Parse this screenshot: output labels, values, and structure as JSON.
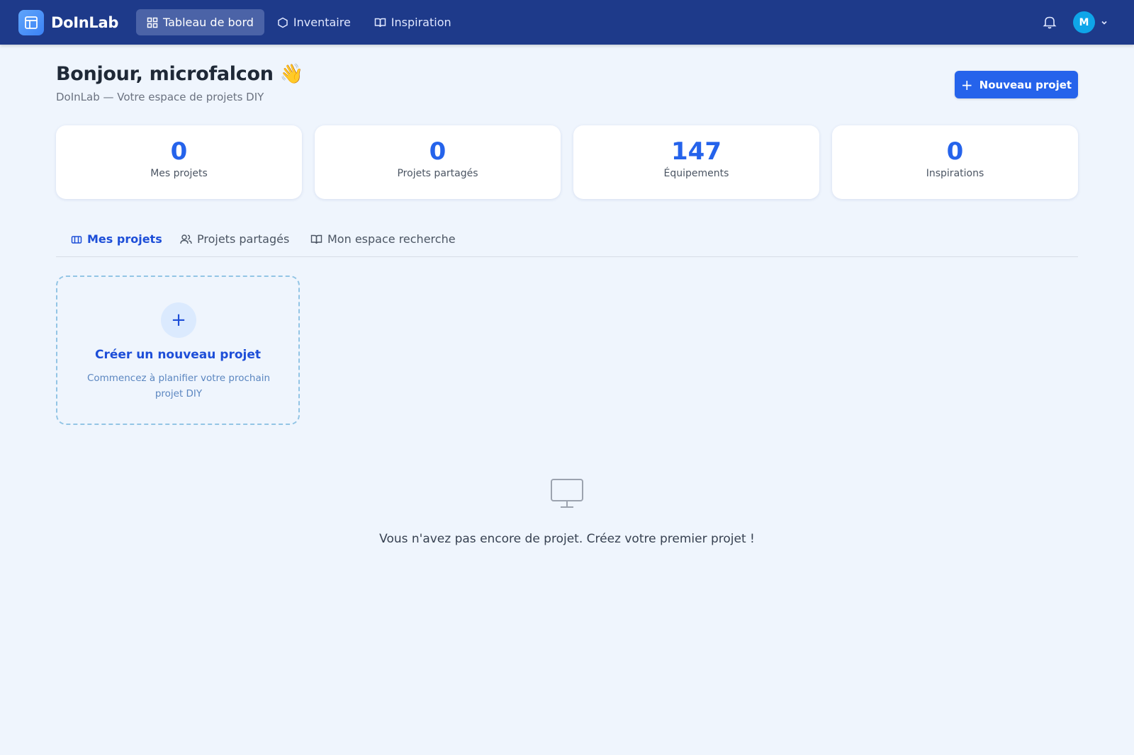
{
  "app": {
    "name": "DoInLab"
  },
  "nav": {
    "items": [
      {
        "label": "Tableau de bord",
        "icon": "dashboard-grid-icon",
        "active": true
      },
      {
        "label": "Inventaire",
        "icon": "hexagon-icon",
        "active": false
      },
      {
        "label": "Inspiration",
        "icon": "book-open-icon",
        "active": false
      }
    ]
  },
  "user": {
    "initial": "M"
  },
  "header": {
    "greeting": "Bonjour, microfalcon 👋",
    "subtitle": "DoInLab — Votre espace de projets DIY",
    "new_project_label": "Nouveau projet"
  },
  "stats": [
    {
      "value": "0",
      "label": "Mes projets"
    },
    {
      "value": "0",
      "label": "Projets partagés"
    },
    {
      "value": "147",
      "label": "Équipements"
    },
    {
      "value": "0",
      "label": "Inspirations"
    }
  ],
  "tabs": [
    {
      "label": "Mes projets",
      "icon": "box-icon",
      "active": true
    },
    {
      "label": "Projets partagés",
      "icon": "users-icon",
      "active": false
    },
    {
      "label": "Mon espace recherche",
      "icon": "book-open-icon",
      "active": false
    }
  ],
  "create_card": {
    "plus": "+",
    "title": "Créer un nouveau projet",
    "description": "Commencez à planifier votre prochain projet DIY"
  },
  "empty_state": {
    "icon": "monitor-icon",
    "message": "Vous n'avez pas encore de projet. Créez votre premier projet !"
  },
  "colors": {
    "topbar": "#1e3a8a",
    "accent": "#2563eb",
    "background": "#eff5fd"
  }
}
